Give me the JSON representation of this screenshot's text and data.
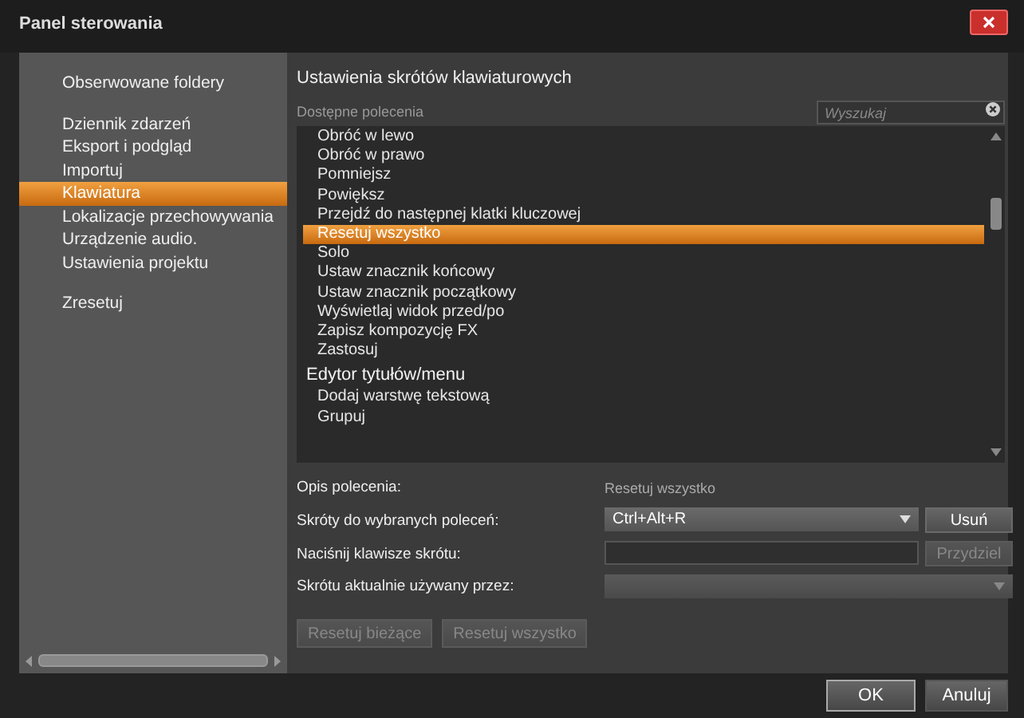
{
  "window": {
    "title": "Panel sterowania"
  },
  "sidebar": {
    "groups": [
      {
        "items": [
          {
            "label": "Obserwowane foldery",
            "selected": false
          }
        ]
      },
      {
        "items": [
          {
            "label": "Dziennik zdarzeń",
            "selected": false
          },
          {
            "label": "Eksport i podgląd",
            "selected": false
          },
          {
            "label": "Importuj",
            "selected": false
          },
          {
            "label": "Klawiatura",
            "selected": true
          },
          {
            "label": "Lokalizacje przechowywania",
            "selected": false
          },
          {
            "label": "Urządzenie audio.",
            "selected": false
          },
          {
            "label": "Ustawienia projektu",
            "selected": false
          }
        ]
      },
      {
        "items": [
          {
            "label": "Zresetuj",
            "selected": false
          }
        ]
      }
    ]
  },
  "shortcuts": {
    "title": "Ustawienia skrótów klawiaturowych",
    "list_label": "Dostępne polecenia",
    "search": {
      "placeholder": "Wyszukaj"
    },
    "sections": [
      {
        "items": [
          {
            "label": "Obróć w lewo",
            "selected": false
          },
          {
            "label": "Obróć w prawo",
            "selected": false
          },
          {
            "label": "Pomniejsz",
            "selected": false
          },
          {
            "label": "Powiększ",
            "selected": false
          },
          {
            "label": "Przejdź do następnej klatki kluczowej",
            "selected": false
          },
          {
            "label": "Resetuj wszystko",
            "selected": true
          },
          {
            "label": "Solo",
            "selected": false
          },
          {
            "label": "Ustaw znacznik końcowy",
            "selected": false
          },
          {
            "label": "Ustaw znacznik początkowy",
            "selected": false
          },
          {
            "label": "Wyświetlaj widok przed/po",
            "selected": false
          },
          {
            "label": "Zapisz kompozycję FX",
            "selected": false
          },
          {
            "label": "Zastosuj",
            "selected": false
          }
        ]
      },
      {
        "header": "Edytor tytułów/menu",
        "items": [
          {
            "label": "Dodaj warstwę tekstową",
            "selected": false
          },
          {
            "label": "Grupuj",
            "selected": false
          }
        ]
      }
    ],
    "description_label": "Opis polecenia:",
    "description": "Resetuj wszystko",
    "shortcuts_label": "Skróty do wybranych poleceń:",
    "shortcut_value": "Ctrl+Alt+R",
    "remove_button": {
      "label": "Usuń",
      "disabled": false
    },
    "press_label": "Naciśnij klawisze skrótu:",
    "assign_button": {
      "label": "Przydziel",
      "disabled": true
    },
    "used_by_label": "Skrótu aktualnie używany przez:",
    "reset_buttons": [
      {
        "label": "Resetuj bieżące",
        "disabled": true
      },
      {
        "label": "Resetuj wszystko",
        "disabled": true
      }
    ]
  },
  "dialog_buttons": [
    {
      "label": "OK",
      "default": true
    },
    {
      "label": "Anuluj",
      "default": false
    }
  ]
}
